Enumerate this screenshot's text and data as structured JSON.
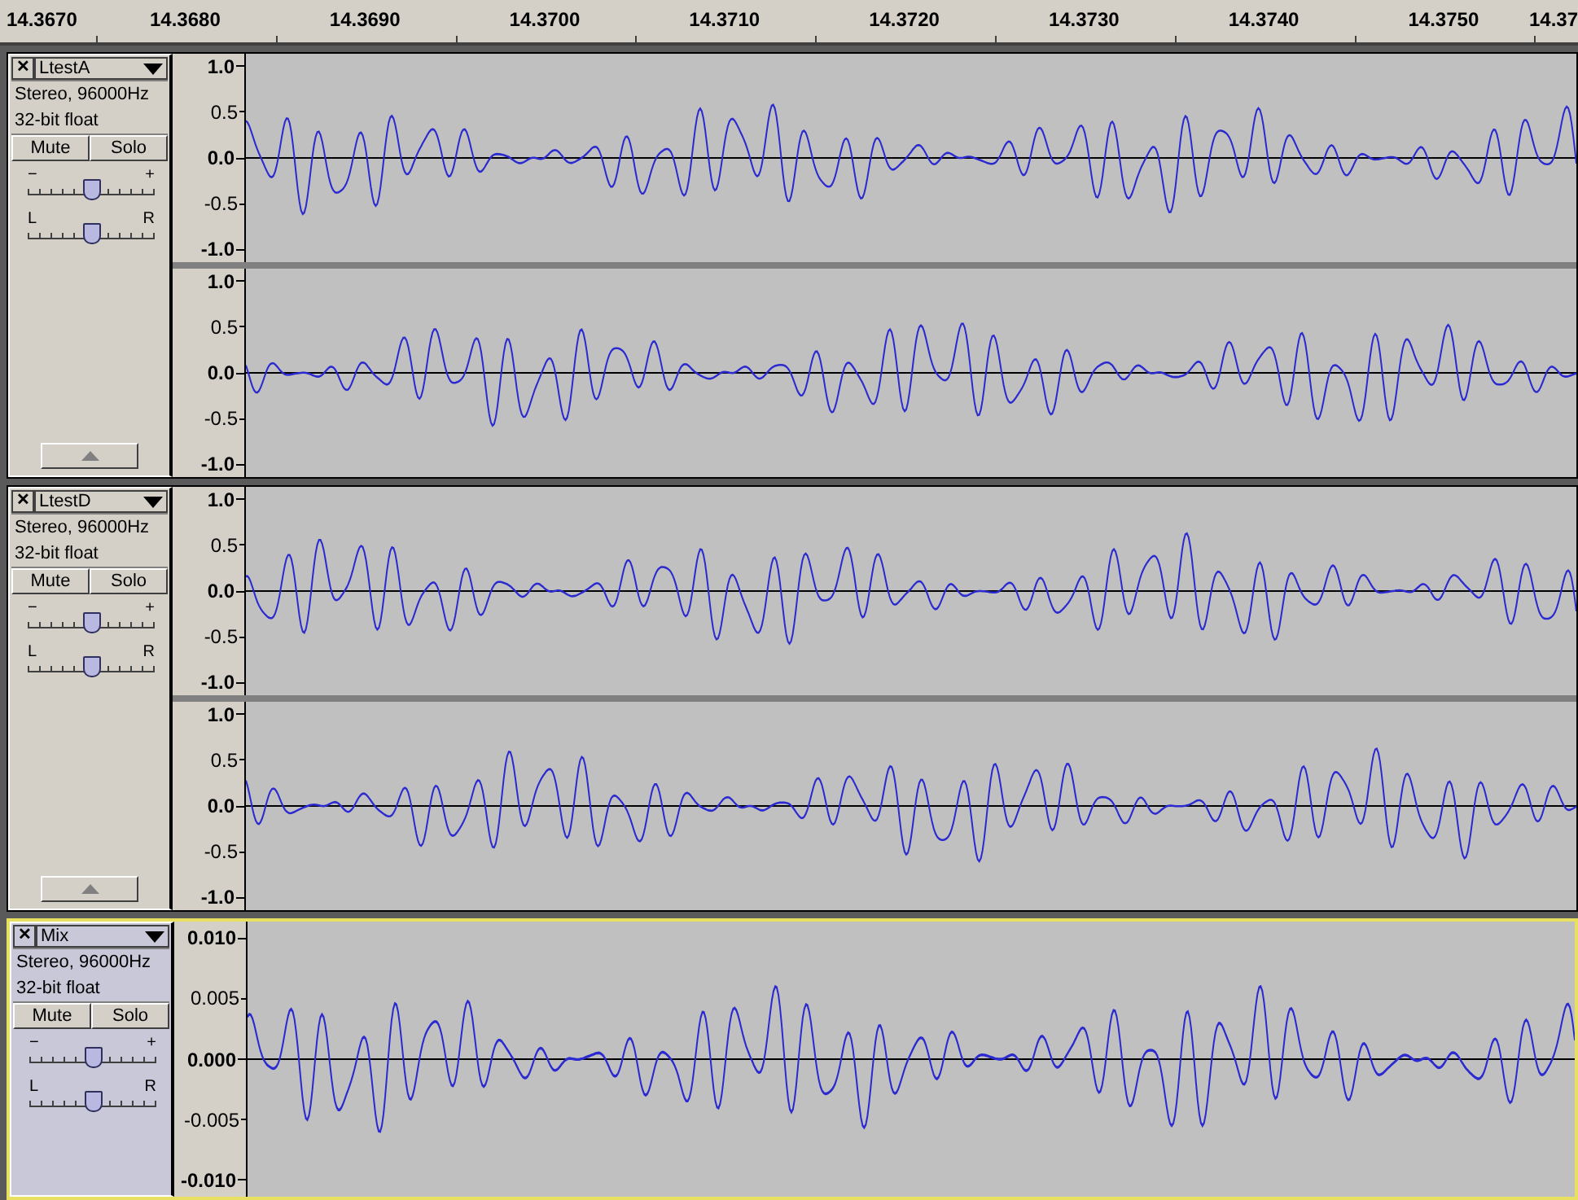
{
  "timeline": {
    "labels": [
      "14.3670",
      "14.3680",
      "14.3690",
      "14.3700",
      "14.3710",
      "14.3720",
      "14.3730",
      "14.3740",
      "14.3750",
      "14.37"
    ]
  },
  "tracks": [
    {
      "name": "LtestA",
      "selected": false,
      "close": "✕",
      "info": [
        "Stereo, 96000Hz",
        "32-bit float"
      ],
      "mute": {
        "label": "Mute",
        "on": false
      },
      "solo": {
        "label": "Solo",
        "on": false
      },
      "gain": {
        "min_label": "−",
        "max_label": "+",
        "level": 0.5
      },
      "pan": {
        "min_label": "L",
        "max_label": "R",
        "level": 0.5
      },
      "collapse_button": true,
      "channels": [
        {
          "scale": [
            {
              "label": "1.0",
              "major": true
            },
            {
              "label": "0.5",
              "major": false
            },
            {
              "label": "0.0",
              "major": true
            },
            {
              "label": "-0.5",
              "major": false
            },
            {
              "label": "-1.0",
              "major": true
            }
          ]
        },
        {
          "scale": [
            {
              "label": "1.0",
              "major": true
            },
            {
              "label": "0.5",
              "major": false
            },
            {
              "label": "0.0",
              "major": true
            },
            {
              "label": "-0.5",
              "major": false
            },
            {
              "label": "-1.0",
              "major": true
            }
          ]
        }
      ]
    },
    {
      "name": "LtestD",
      "selected": false,
      "close": "✕",
      "info": [
        "Stereo, 96000Hz",
        "32-bit float"
      ],
      "mute": {
        "label": "Mute",
        "on": false
      },
      "solo": {
        "label": "Solo",
        "on": false
      },
      "gain": {
        "min_label": "−",
        "max_label": "+",
        "level": 0.5
      },
      "pan": {
        "min_label": "L",
        "max_label": "R",
        "level": 0.5
      },
      "collapse_button": true,
      "channels": [
        {
          "scale": [
            {
              "label": "1.0",
              "major": true
            },
            {
              "label": "0.5",
              "major": false
            },
            {
              "label": "0.0",
              "major": true
            },
            {
              "label": "-0.5",
              "major": false
            },
            {
              "label": "-1.0",
              "major": true
            }
          ]
        },
        {
          "scale": [
            {
              "label": "1.0",
              "major": true
            },
            {
              "label": "0.5",
              "major": false
            },
            {
              "label": "0.0",
              "major": true
            },
            {
              "label": "-0.5",
              "major": false
            },
            {
              "label": "-1.0",
              "major": true
            }
          ]
        }
      ]
    },
    {
      "name": "Mix",
      "selected": true,
      "close": "✕",
      "info": [
        "Stereo, 96000Hz",
        "32-bit float"
      ],
      "mute": {
        "label": "Mute",
        "on": false
      },
      "solo": {
        "label": "Solo",
        "on": false
      },
      "gain": {
        "min_label": "−",
        "max_label": "+",
        "level": 0.5
      },
      "pan": {
        "min_label": "L",
        "max_label": "R",
        "level": 0.5
      },
      "channels": [
        {
          "scale": [
            {
              "label": "0.010",
              "major": true
            },
            {
              "label": "0.005",
              "major": false
            },
            {
              "label": "0.000",
              "major": true
            },
            {
              "label": "-0.005",
              "major": false
            },
            {
              "label": "-0.010",
              "major": true
            }
          ]
        }
      ]
    }
  ]
}
